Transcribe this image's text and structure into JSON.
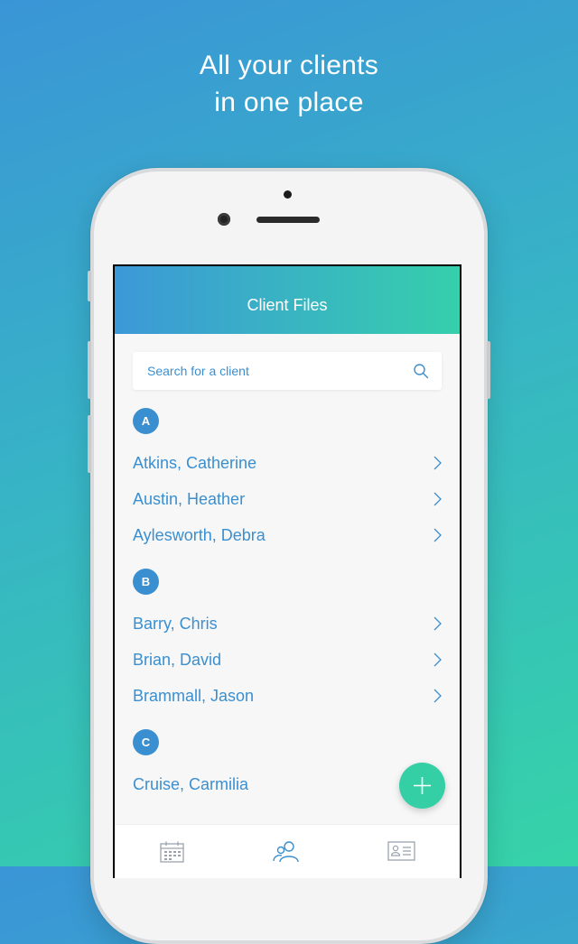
{
  "headline": {
    "line1": "All your clients",
    "line2": "in one place"
  },
  "app": {
    "title": "Client Files",
    "search": {
      "placeholder": "Search for a client",
      "value": ""
    },
    "sections": [
      {
        "letter": "A",
        "clients": [
          "Atkins, Catherine",
          "Austin, Heather",
          "Aylesworth, Debra"
        ]
      },
      {
        "letter": "B",
        "clients": [
          "Barry, Chris",
          "Brian, David",
          "Brammall, Jason"
        ]
      },
      {
        "letter": "C",
        "clients": [
          "Cruise, Carmilia"
        ]
      }
    ],
    "tabs": [
      {
        "icon": "calendar-icon",
        "active": false
      },
      {
        "icon": "clients-icon",
        "active": true
      },
      {
        "icon": "id-card-icon",
        "active": false
      }
    ],
    "colors": {
      "accent": "#3a8fd0",
      "fab": "#35cfa6",
      "inactive_icon": "#9aa3ad"
    }
  }
}
